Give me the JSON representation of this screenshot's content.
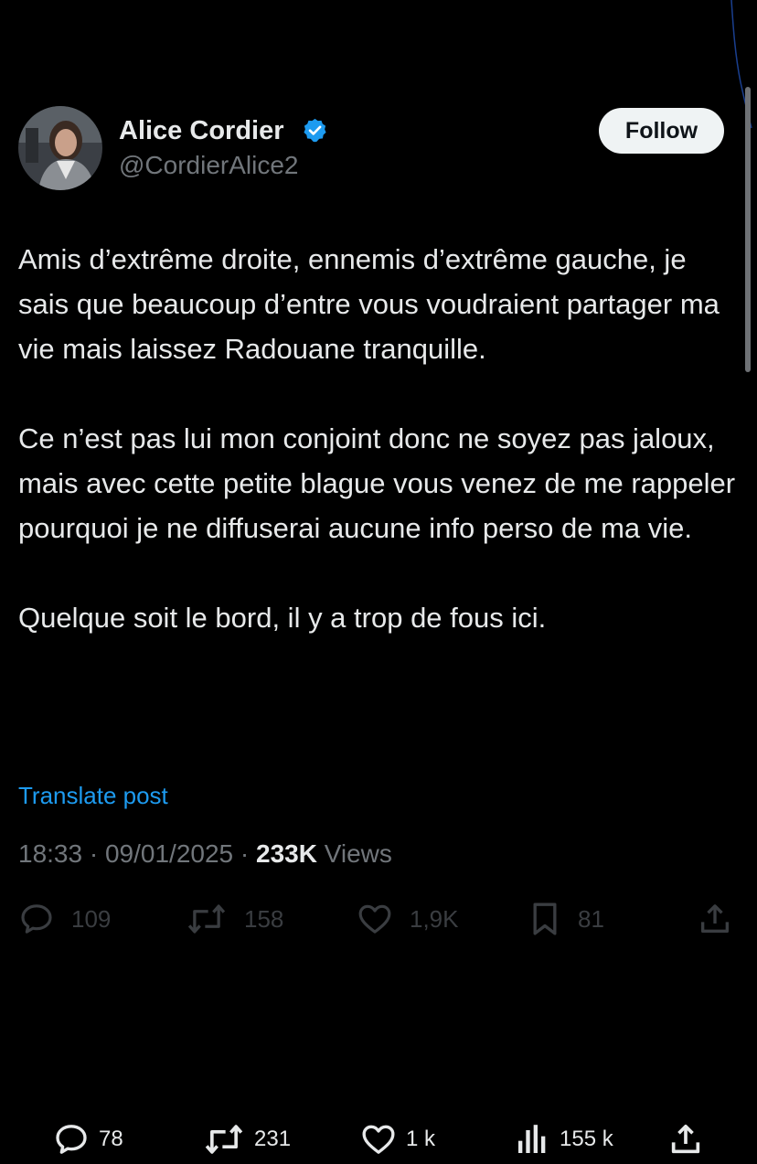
{
  "author": {
    "display_name": "Alice Cordier",
    "handle": "@CordierAlice2",
    "verified_color": "#1d9bf0"
  },
  "follow_label": "Follow",
  "tweet": {
    "paragraphs": [
      "Amis d’extrême droite, ennemis d’extrême gauche, je sais que beaucoup d’entre vous voudraient partager ma vie mais laissez Radouane tranquille.",
      "Ce n’est pas lui mon conjoint donc ne soyez pas jaloux, mais avec cette petite blague vous venez de me rappeler pourquoi je ne diffuserai aucune info perso de ma vie.",
      "Quelque soit le bord, il y a trop de fous ici."
    ],
    "translate_label": "Translate post",
    "time": "18:33",
    "date": "09/01/2025",
    "views_count": "233K",
    "views_label": "Views"
  },
  "actions": {
    "replies": "109",
    "reposts": "158",
    "likes": "1,9K",
    "bookmarks": "81"
  },
  "bottom_bar": {
    "replies": "78",
    "reposts": "231",
    "likes": "1 k",
    "views": "155 k"
  },
  "colors": {
    "background": "#000000",
    "text": "#e7e9ea",
    "muted": "#71767b",
    "link": "#1d9bf0",
    "dim_actions": "#3a3d41"
  }
}
